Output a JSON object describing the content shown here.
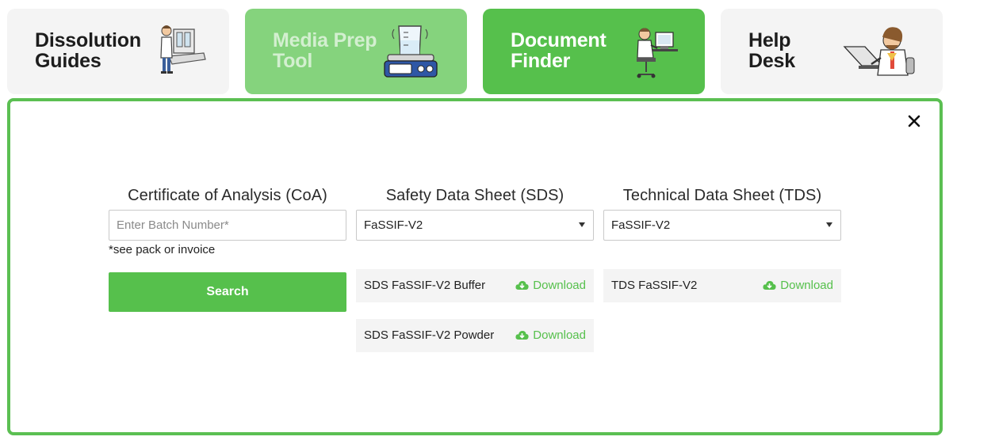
{
  "tabs": [
    {
      "title": "Dissolution\nGuides"
    },
    {
      "title": "Media Prep\nTool"
    },
    {
      "title": "Document\nFinder"
    },
    {
      "title": "Help\nDesk"
    }
  ],
  "coa": {
    "title": "Certificate of Analysis (CoA)",
    "placeholder": "Enter Batch Number*",
    "note": "*see pack or invoice",
    "search_label": "Search"
  },
  "sds": {
    "title": "Safety Data Sheet (SDS)",
    "selected": "FaSSIF-V2",
    "documents": [
      {
        "name": "SDS FaSSIF-V2 Buffer",
        "action": "Download"
      },
      {
        "name": "SDS FaSSIF-V2 Powder",
        "action": "Download"
      }
    ]
  },
  "tds": {
    "title": "Technical Data Sheet (TDS)",
    "selected": "FaSSIF-V2",
    "documents": [
      {
        "name": "TDS FaSSIF-V2",
        "action": "Download"
      }
    ]
  },
  "colors": {
    "brand_green": "#56c04c",
    "light_green": "#85d37d",
    "panel_border": "#5bbf52"
  },
  "icons": [
    "scientist-lab-illustration",
    "stirrer-beaker-illustration",
    "scientist-computer-illustration",
    "scientist-laptop-illustration",
    "close-icon",
    "cloud-download-icon",
    "dropdown-caret-icon"
  ]
}
